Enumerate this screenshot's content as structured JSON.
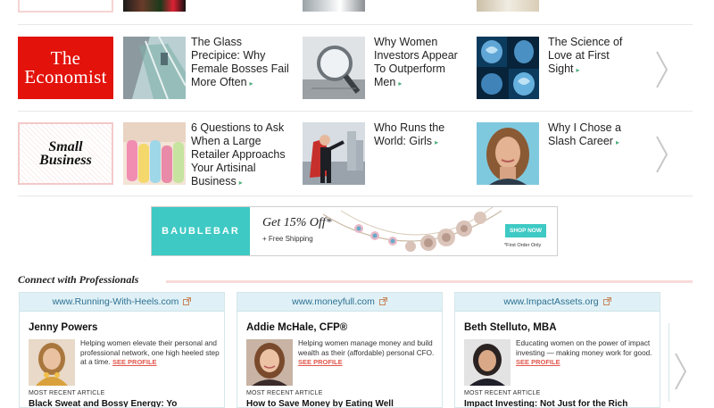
{
  "articles": {
    "row1": {
      "publisher": {
        "line1": "The",
        "line2": "Economist"
      },
      "items": [
        {
          "title": "The Glass Precipice: Why Female Bosses Fail More Often"
        },
        {
          "title": "Why Women Investors Appear To Outperform Men"
        },
        {
          "title": "The Science of Love at First Sight"
        }
      ]
    },
    "row2": {
      "publisher": {
        "line1": "Small",
        "line2": "Business"
      },
      "items": [
        {
          "title": "6 Questions to Ask When a Large Retailer Approachs Your Artisinal Business"
        },
        {
          "title": "Who Runs the World: Girls"
        },
        {
          "title": "Why I Chose a Slash Career"
        }
      ]
    },
    "arrow_glyph": "▸"
  },
  "ad": {
    "brand": "BAUBLEBAR",
    "offer": "Get 15% Off*",
    "shipping": "+ Free Shipping",
    "cta": "SHOP NOW",
    "note": "*First Order Only"
  },
  "connect": {
    "title": "Connect with Professionals",
    "recent_label": "MOST RECENT ARTICLE",
    "see_profile": "SEE PROFILE",
    "cards": [
      {
        "site": "www.Running-With-Heels.com",
        "name": "Jenny Powers",
        "bio": "Helping women elevate their personal and professional network, one high heeled step at a time.",
        "article": "Black Sweat and Bossy Energy: Yo"
      },
      {
        "site": "www.moneyfull.com",
        "name": "Addie McHale, CFP®",
        "bio": "Helping women manage money and build wealth as their (affordable) personal CFO.",
        "article": "How to Save Money by Eating Well"
      },
      {
        "site": "www.ImpactAssets.org",
        "name": "Beth Stelluto, MBA",
        "bio": "Educating women on the power of impact investing — making money work for good.",
        "article": "Impact Investing: Not Just for the Rich"
      }
    ]
  },
  "icons": {
    "external_link": "external-link-icon",
    "carousel_next": "chevron-right-icon"
  },
  "colors": {
    "economist_red": "#e3120b",
    "brand_teal": "#3ec9c4",
    "link_blue": "#2d6f92",
    "see_profile_red": "#e2574c",
    "title_arrow_green": "#4caf7d"
  }
}
